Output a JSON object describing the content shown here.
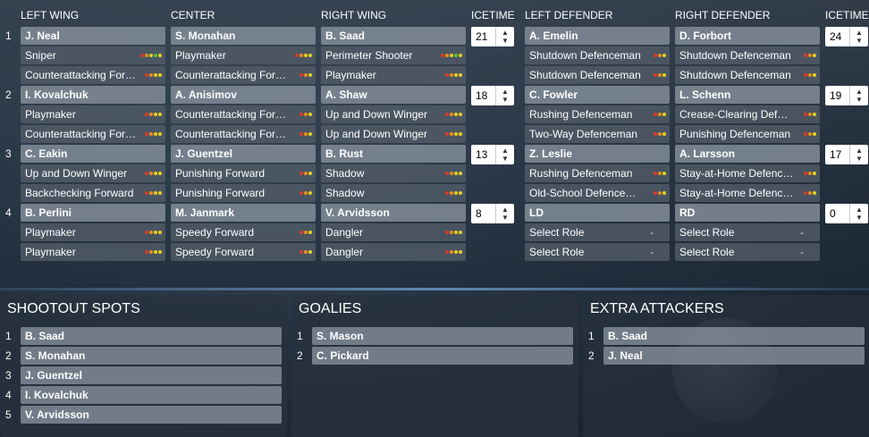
{
  "headers": {
    "left_wing": "LEFT WING",
    "center": "CENTER",
    "right_wing": "RIGHT WING",
    "icetime_f": "ICETIME",
    "left_defender": "LEFT DEFENDER",
    "right_defender": "RIGHT DEFENDER",
    "icetime_d": "ICETIME"
  },
  "lines": [
    {
      "num": "1",
      "lw": {
        "player": "J. Neal",
        "role1": "Sniper",
        "role2": "Counterattacking For…"
      },
      "c": {
        "player": "S. Monahan",
        "role1": "Playmaker",
        "role2": "Counterattacking For…"
      },
      "rw": {
        "player": "B. Saad",
        "role1": "Perimeter Shooter",
        "role2": "Playmaker"
      },
      "icetime_f": "21",
      "ld": {
        "player": "A. Emelin",
        "role1": "Shutdown Defenceman",
        "role2": "Shutdown Defenceman"
      },
      "rd": {
        "player": "D. Forbort",
        "role1": "Shutdown Defenceman",
        "role2": "Shutdown Defenceman"
      },
      "icetime_d": "24"
    },
    {
      "num": "2",
      "lw": {
        "player": "I. Kovalchuk",
        "role1": "Playmaker",
        "role2": "Counterattacking For…"
      },
      "c": {
        "player": "A. Anisimov",
        "role1": "Counterattacking For…",
        "role2": "Counterattacking For…"
      },
      "rw": {
        "player": "A. Shaw",
        "role1": "Up and Down Winger",
        "role2": "Up and Down Winger"
      },
      "icetime_f": "18",
      "ld": {
        "player": "C. Fowler",
        "role1": "Rushing Defenceman",
        "role2": "Two-Way Defenceman"
      },
      "rd": {
        "player": "L. Schenn",
        "role1": "Crease-Clearing Def…",
        "role2": "Punishing Defenceman"
      },
      "icetime_d": "19"
    },
    {
      "num": "3",
      "lw": {
        "player": "C. Eakin",
        "role1": "Up and Down Winger",
        "role2": "Backchecking Forward"
      },
      "c": {
        "player": "J. Guentzel",
        "role1": "Punishing Forward",
        "role2": "Punishing Forward"
      },
      "rw": {
        "player": "B. Rust",
        "role1": "Shadow",
        "role2": "Shadow"
      },
      "icetime_f": "13",
      "ld": {
        "player": "Z. Leslie",
        "role1": "Rushing Defenceman",
        "role2": "Old-School Defence…"
      },
      "rd": {
        "player": "A. Larsson",
        "role1": "Stay-at-Home Defenc…",
        "role2": "Stay-at-Home Defenc…"
      },
      "icetime_d": "17"
    },
    {
      "num": "4",
      "lw": {
        "player": "B. Perlini",
        "role1": "Playmaker",
        "role2": "Playmaker"
      },
      "c": {
        "player": "M. Janmark",
        "role1": "Speedy Forward",
        "role2": "Speedy Forward"
      },
      "rw": {
        "player": "V. Arvidsson",
        "role1": "Dangler",
        "role2": "Dangler"
      },
      "icetime_f": "8",
      "ld": {
        "player": "LD",
        "role1": "Select Role",
        "role2": "Select Role"
      },
      "rd": {
        "player": "RD",
        "role1": "Select Role",
        "role2": "Select Role"
      },
      "icetime_d": "0"
    }
  ],
  "select_role_dash": "-",
  "rating_colors": {
    "red": "#d83a2a",
    "orange": "#e8901c",
    "yellow": "#e6d21a",
    "green": "#5cc23a"
  },
  "shootout": {
    "title": "SHOOTOUT SPOTS",
    "rows": [
      {
        "num": "1",
        "name": "B. Saad"
      },
      {
        "num": "2",
        "name": "S. Monahan"
      },
      {
        "num": "3",
        "name": "J. Guentzel"
      },
      {
        "num": "4",
        "name": "I. Kovalchuk"
      },
      {
        "num": "5",
        "name": "V. Arvidsson"
      }
    ]
  },
  "goalies": {
    "title": "GOALIES",
    "rows": [
      {
        "num": "1",
        "name": "S. Mason"
      },
      {
        "num": "2",
        "name": "C. Pickard"
      }
    ]
  },
  "extra_attackers": {
    "title": "EXTRA ATTACKERS",
    "rows": [
      {
        "num": "1",
        "name": "B. Saad"
      },
      {
        "num": "2",
        "name": "J. Neal"
      }
    ]
  }
}
